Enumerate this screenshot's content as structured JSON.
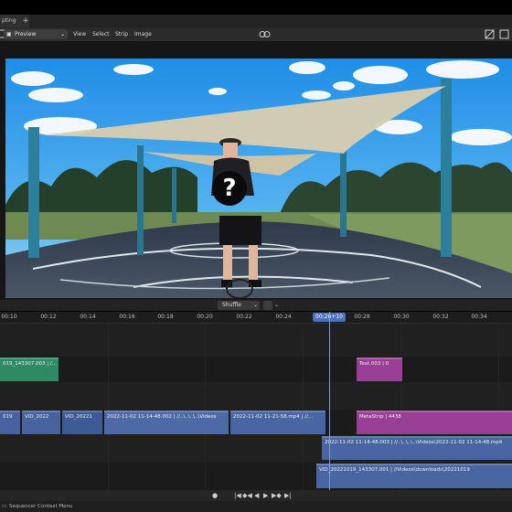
{
  "tabs": {
    "current_tab_label": "pting",
    "add_tab": "+"
  },
  "toolbar": {
    "editor_type_icon": "sequencer-editor-icon",
    "preview_label": "Preview",
    "menu_view": "View",
    "menu_select": "Select",
    "menu_strip": "Strip",
    "menu_image": "Image"
  },
  "preview": {
    "overlay_icon": "question-mark-icon",
    "overlay_glyph": "?"
  },
  "timeline_header": {
    "shuffle_label": "Shuffle"
  },
  "ruler": {
    "ticks": [
      "00:10",
      "00:12",
      "00:14",
      "00:16",
      "00:18",
      "00:20",
      "00:22",
      "00:24",
      "00:28",
      "00:30",
      "00:32",
      "00:34"
    ],
    "playhead_label": "00:26+10"
  },
  "strips": {
    "top_green": "019_143307.003 | /...",
    "top_purple": "Text.003 | 0",
    "row2_a": "019",
    "row2_b": "VID_2022",
    "row2_c": "VID_20221",
    "row2_d": "2022-11-02 11-14-48.002 | //..\\..\\..\\..\\Videos",
    "row2_e": "2022-11-02 11-21-58.mp4 | //...",
    "row2_meta": "MetaStrip | 4438",
    "row3_a": "2022-11-02 11-14-48.003 | //..\\..\\..\\..\\Videos\\2022-11-02 11-14-48.mp4",
    "row4_a": "VID_20221019_143307.001 | //Videos\\downloads\\20221019"
  },
  "transport": {
    "record": "●",
    "jump_start": "|◀",
    "prev_key": "◆◀",
    "play_reverse": "◀",
    "play": "▶",
    "next_key": "▶◆",
    "jump_end": "▶|"
  },
  "status": {
    "context_menu_label": "Sequencer Context Menu"
  }
}
